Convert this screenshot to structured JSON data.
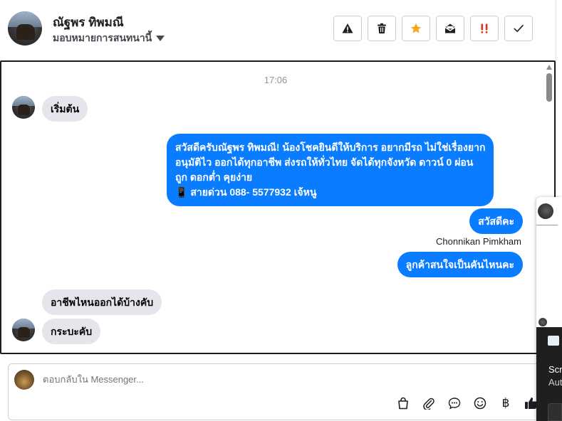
{
  "header": {
    "contact_name": "ณัฐพร ทิพมณี",
    "assign_label": "มอบหมายการสนทนานี้",
    "actions": [
      {
        "icon": "warning-icon",
        "color": "#1c1e21"
      },
      {
        "icon": "trash-icon",
        "color": "#1c1e21"
      },
      {
        "icon": "star-icon",
        "color": "#f5a623"
      },
      {
        "icon": "envelope-open-icon",
        "color": "#1c1e21"
      },
      {
        "icon": "urgent-icon",
        "color": "#d93025"
      },
      {
        "icon": "check-icon",
        "color": "#1c1e21"
      }
    ]
  },
  "thread": {
    "timestamp": "17:06",
    "messages": [
      {
        "direction": "in",
        "text": "เริ่มต้น"
      },
      {
        "direction": "out",
        "lines": [
          "สวัสดีครับณัฐพร ทิพมณี! น้องโชคยินดีให้บริการ อยากมีรถ ไม่ใช่เรื่องยาก",
          "อนุมัติไว ออกได้ทุกอาชีพ ส่งรถให้ทั่วไทย จัดได้ทุกจังหวัด ดาวน์ 0  ผ่อน",
          "ถูก ดอกต่ำ คุยง่าย",
          "📱 สายด่วน 088- 5577932 เจ้หนู"
        ]
      },
      {
        "direction": "out",
        "text": "สวัสดีคะ"
      },
      {
        "direction": "meta",
        "text": "Chonnikan Pimkham"
      },
      {
        "direction": "out",
        "text": "ลูกค้าสนใจเป็นคันไหนคะ"
      },
      {
        "direction": "in",
        "text": "อาชีพไหนออกได้บ้างคับ"
      },
      {
        "direction": "in",
        "text": "กระบะคับ"
      }
    ]
  },
  "composer": {
    "placeholder": "ตอบกลับใน Messenger...",
    "tools": [
      {
        "icon": "shopping-bag-icon"
      },
      {
        "icon": "paperclip-icon"
      },
      {
        "icon": "chat-bubble-icon"
      },
      {
        "icon": "emoji-icon"
      },
      {
        "icon": "baht-icon",
        "glyph": "฿"
      },
      {
        "icon": "thumbs-up-icon"
      }
    ]
  },
  "overlay": {
    "text1": "Scr",
    "text2": "Aut"
  }
}
